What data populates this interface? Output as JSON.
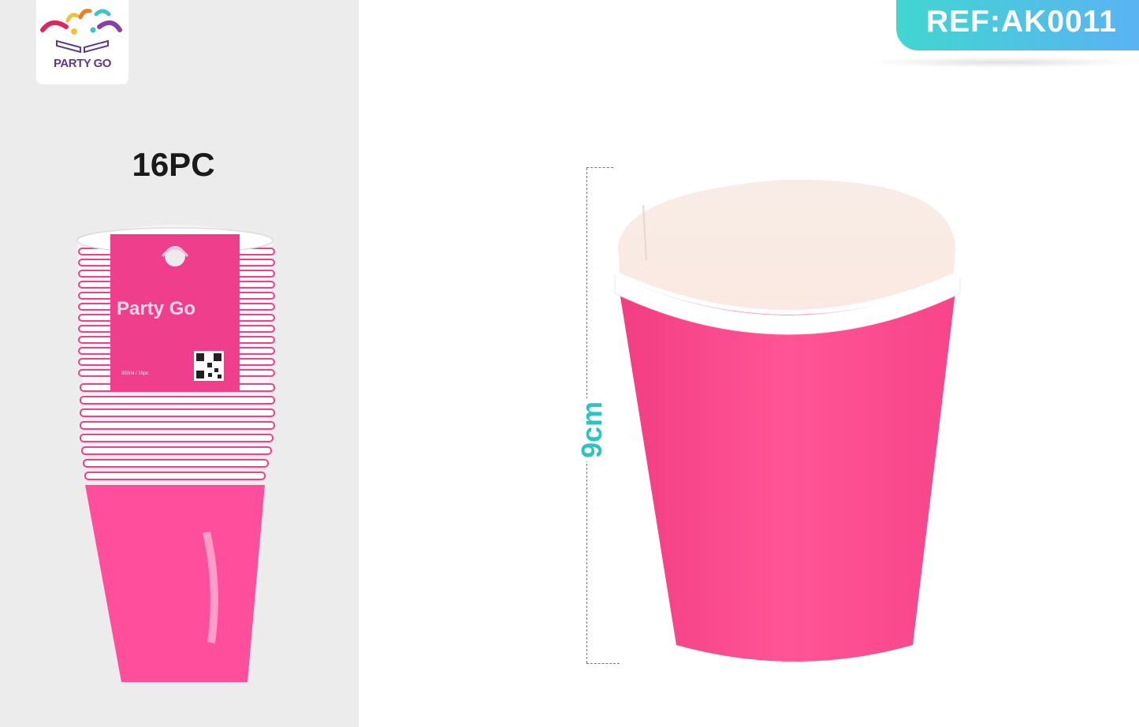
{
  "brand": {
    "logo_text": "PARTY GO"
  },
  "product": {
    "pack_count": "16PC",
    "ref": "REF:AK0011",
    "height_label": "9cm",
    "package_label_brand": "Party Go",
    "package_label_small": "350ml / 16pc",
    "accent_color": "#ff4f8e",
    "tab_gradient": [
      "#41d6d0",
      "#5ab3f2"
    ]
  },
  "icons": [
    "confetti-logo-icon",
    "qr-code-icon"
  ]
}
